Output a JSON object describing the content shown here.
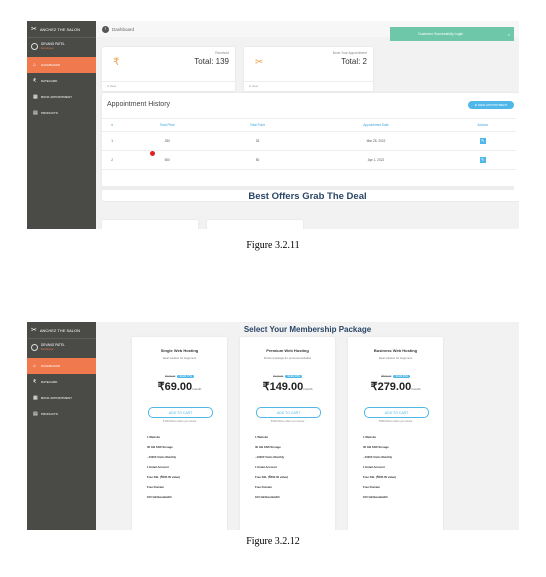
{
  "figure1": {
    "sidebar": {
      "brand": "ANCHEZ THE SALON",
      "user_name": "DEVANG PATEL",
      "user_role": "Employee",
      "nav": [
        "DASHBOARD",
        "DATECARD",
        "BOOK APPOINTMENT",
        "PRODUCTS"
      ]
    },
    "topbar": {
      "breadcrumb": "Dashboard"
    },
    "toast": {
      "message": "Customer Successfully Login",
      "close": "×"
    },
    "stats": [
      {
        "icon": "₹",
        "name": "Received",
        "total": "Total: 139",
        "link": "View"
      },
      {
        "icon": "✂",
        "name": "Book Your Appointment",
        "total": "Total: 2",
        "link": "View"
      }
    ],
    "history": {
      "title": "Appointment History",
      "new_button": "⊕ NEW APPOINTMENT",
      "columns": [
        "#",
        "Total Price",
        "Total Point",
        "Appointment Date",
        "Actions"
      ],
      "rows": [
        [
          "1",
          "250",
          "25",
          "Mar 25, 2022",
          "✎"
        ],
        [
          "2",
          "500",
          "50",
          "Apr 1, 2022",
          "✎"
        ]
      ]
    },
    "offers_heading": "Best Offers Grab The Deal"
  },
  "caption1": "Figure 3.2.11",
  "figure2": {
    "title": "Select Your Membership Package",
    "plans": [
      {
        "name": "Single Web Hosting",
        "subtitle": "Ideal solution for beginners",
        "old_price": "₹109.00",
        "save": "SAVE 77%",
        "price": "₹69.00",
        "per": "/month",
        "cta": "ADD TO CART",
        "renew": "₹109.00/mo when you renew",
        "features": [
          "1 Website",
          "30 GB SSD Storage",
          "~10000 Visits Monthly",
          "1 Email Account",
          "Free SSL (₹800.00 value)",
          "Free Domain",
          "100 GB Bandwidth"
        ]
      },
      {
        "name": "Premium Web Hosting",
        "subtitle": "Perfect package for personal websites",
        "old_price": "₹249.00",
        "save": "SAVE 40%",
        "price": "₹149.00",
        "per": "/month",
        "cta": "ADD TO CART",
        "renew": "₹249.00/mo when you renew",
        "features": [
          "1 Website",
          "30 GB SSD Storage",
          "~10000 Visits Monthly",
          "1 Email Account",
          "Free SSL (₹800.00 value)",
          "Free Domain",
          "100 GB Bandwidth"
        ]
      },
      {
        "name": "Business Web Hosting",
        "subtitle": "Ideal solution for beginners",
        "old_price": "₹599.00",
        "save": "SAVE 53%",
        "price": "₹279.00",
        "per": "/month",
        "cta": "ADD TO CART",
        "renew": "₹599.00/mo when you renew",
        "features": [
          "1 Website",
          "30 GB SSD Storage",
          "~10000 Visits Monthly",
          "1 Email Account",
          "Free SSL (₹800.00 value)",
          "Free Domain",
          "100 GB Bandwidth"
        ]
      }
    ]
  },
  "caption2": "Figure 3.2.12",
  "colors": {
    "sidebar": "#4a4a47",
    "accent": "#f07a4d",
    "toast": "#6fc7a9",
    "primary": "#4fb8e8",
    "heading": "#2a4566"
  }
}
